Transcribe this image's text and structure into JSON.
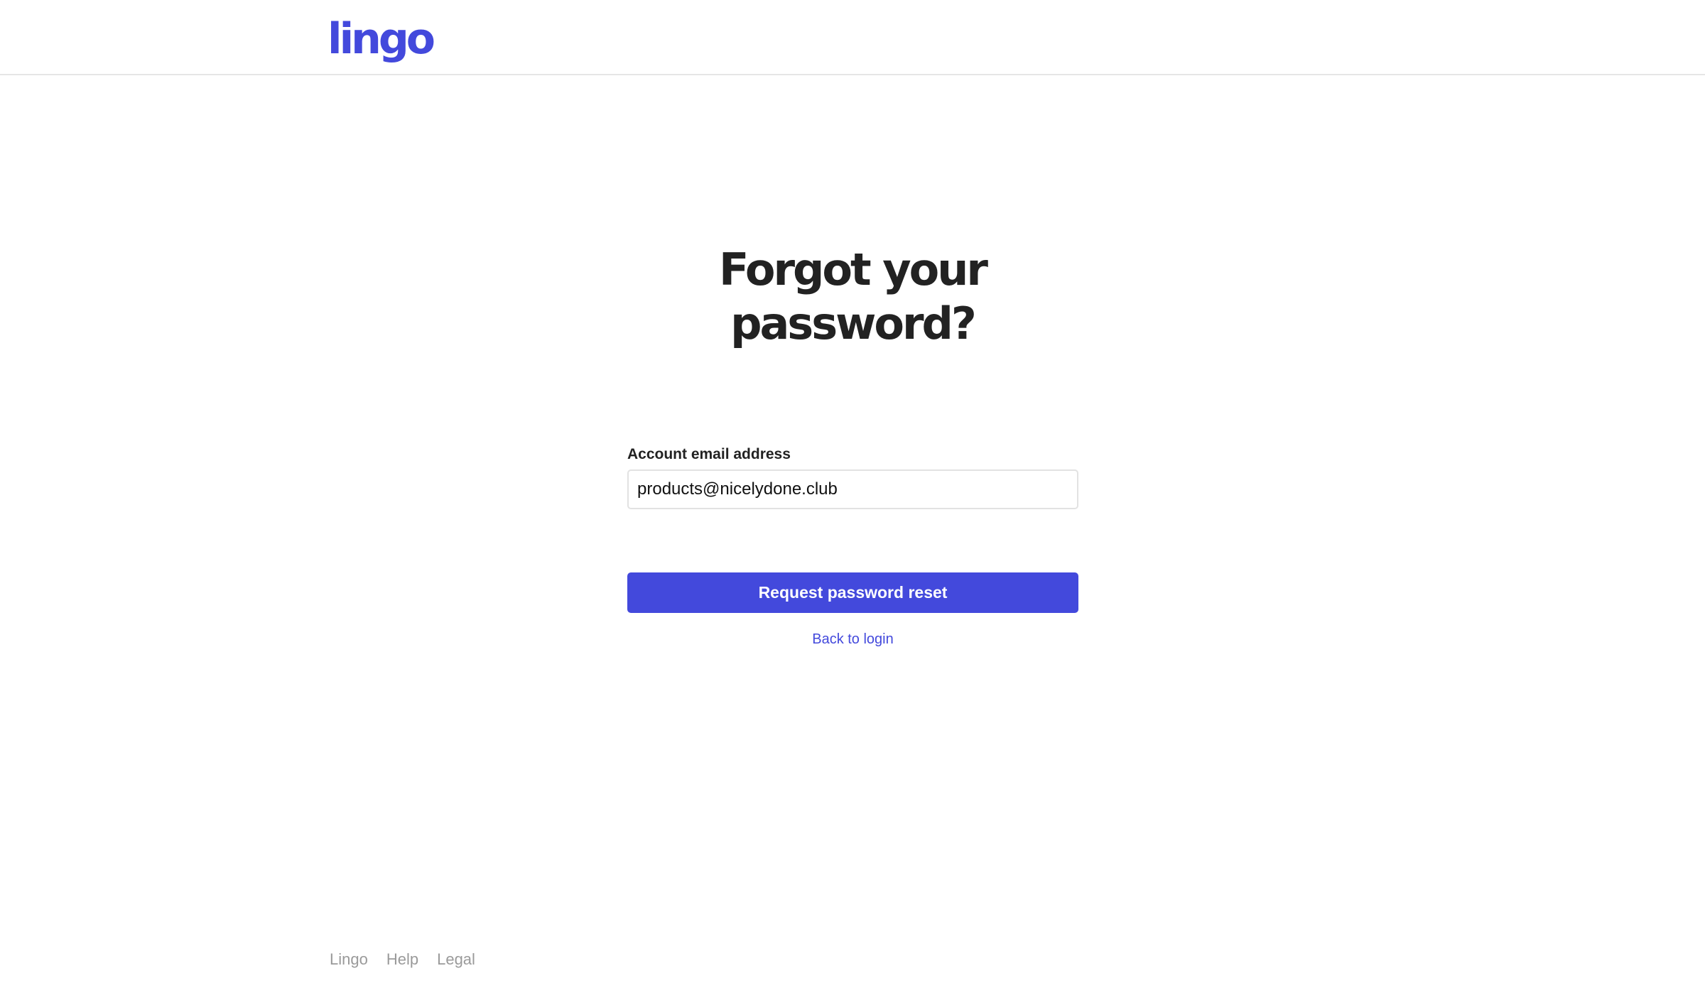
{
  "header": {
    "logo_text": "lingo"
  },
  "main": {
    "title_line1": "Forgot your",
    "title_line2": "password?",
    "email_label": "Account email address",
    "email_value": "products@nicelydone.club",
    "submit_label": "Request password reset",
    "back_link_label": "Back to login"
  },
  "footer": {
    "links": [
      "Lingo",
      "Help",
      "Legal"
    ]
  },
  "colors": {
    "brand": "#4349dc",
    "text": "#222222",
    "muted": "#9a9a9a",
    "border": "#e2e2e2"
  }
}
